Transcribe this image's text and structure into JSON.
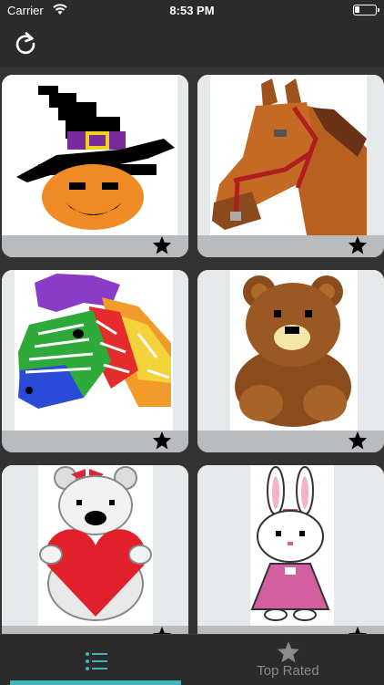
{
  "status": {
    "carrier": "Carrier",
    "time": "8:53 PM"
  },
  "tabs": {
    "list_label": "",
    "top_rated_label": "Top Rated"
  },
  "colors": {
    "accent": "#3fb2c0",
    "card_footer": "#b9bcbf",
    "background": "#2b2b2b"
  },
  "cards": [
    {
      "name": "witch-pumpkin"
    },
    {
      "name": "horse"
    },
    {
      "name": "rainbow-zebra"
    },
    {
      "name": "teddy-bear"
    },
    {
      "name": "white-bear-heart"
    },
    {
      "name": "bunny-pink-dress"
    }
  ]
}
